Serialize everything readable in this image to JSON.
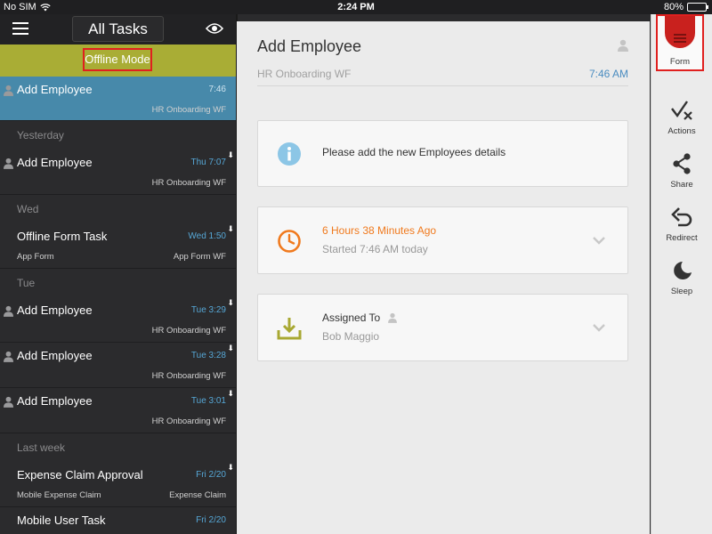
{
  "status": {
    "carrier": "No SIM",
    "time": "2:24 PM",
    "battery": "80%",
    "battery_level": 0.8
  },
  "left": {
    "title": "All Tasks",
    "offline_label": "Offline Mode",
    "rows": [
      {
        "kind": "task",
        "selected": true,
        "user_icon": true,
        "title": "Add Employee",
        "time": "7:46",
        "sub_left": "",
        "sub_right": "HR Onboarding WF",
        "download": false
      },
      {
        "kind": "section",
        "label": "Yesterday"
      },
      {
        "kind": "task",
        "selected": false,
        "user_icon": true,
        "title": "Add Employee",
        "time": "Thu 7:07",
        "sub_left": "",
        "sub_right": "HR Onboarding WF",
        "download": true
      },
      {
        "kind": "section",
        "label": "Wed"
      },
      {
        "kind": "task",
        "selected": false,
        "user_icon": false,
        "title": "Offline Form Task",
        "time": "Wed 1:50",
        "sub_left": "App Form",
        "sub_right": "App Form WF",
        "download": true
      },
      {
        "kind": "section",
        "label": "Tue"
      },
      {
        "kind": "task",
        "selected": false,
        "user_icon": true,
        "title": "Add Employee",
        "time": "Tue 3:29",
        "sub_left": "",
        "sub_right": "HR Onboarding WF",
        "download": true
      },
      {
        "kind": "task",
        "selected": false,
        "user_icon": true,
        "title": "Add Employee",
        "time": "Tue 3:28",
        "sub_left": "",
        "sub_right": "HR Onboarding WF",
        "download": true
      },
      {
        "kind": "task",
        "selected": false,
        "user_icon": true,
        "title": "Add Employee",
        "time": "Tue 3:01",
        "sub_left": "",
        "sub_right": "HR Onboarding WF",
        "download": true
      },
      {
        "kind": "section",
        "label": "Last week"
      },
      {
        "kind": "task",
        "selected": false,
        "user_icon": false,
        "title": "Expense Claim Approval",
        "time": "Fri 2/20",
        "sub_left": "Mobile Expense Claim",
        "sub_right": "Expense Claim",
        "download": true
      },
      {
        "kind": "task",
        "selected": false,
        "user_icon": false,
        "title": "Mobile User Task",
        "time": "Fri 2/20",
        "sub_left": "",
        "sub_right": "",
        "download": false
      }
    ]
  },
  "main": {
    "title": "Add Employee",
    "workflow": "HR Onboarding WF",
    "time": "7:46 AM",
    "info_text": "Please add the new Employees details",
    "elapsed": "6 Hours 38 Minutes Ago",
    "started": "Started 7:46 AM today",
    "assigned_label": "Assigned To",
    "assignee": "Bob Maggio"
  },
  "sidebar": {
    "form": "Form",
    "actions": "Actions",
    "share": "Share",
    "redirect": "Redirect",
    "sleep": "Sleep"
  },
  "colors": {
    "accent_blue": "#4789aa",
    "offline_bar": "#a9ad35",
    "highlight_red": "#e0201f",
    "elapsed_orange": "#f07a1e",
    "form_red": "#c9211e"
  }
}
